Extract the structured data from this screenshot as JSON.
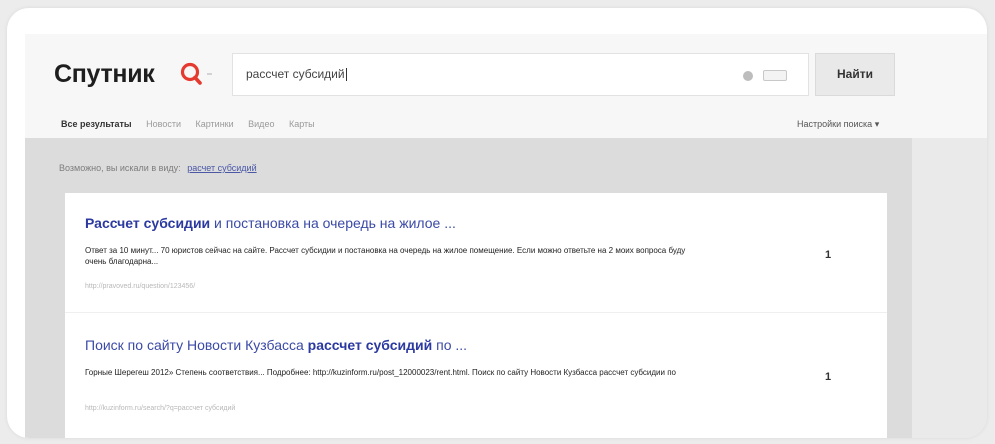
{
  "header": {
    "logo_text": "Спутник",
    "search_value": "рассчет субсидий",
    "find_button": "Найти"
  },
  "tabs": [
    {
      "label": "Все результаты",
      "active": true
    },
    {
      "label": "Новости",
      "active": false
    },
    {
      "label": "Картинки",
      "active": false
    },
    {
      "label": "Видео",
      "active": false
    },
    {
      "label": "Карты",
      "active": false
    }
  ],
  "settings_label": "Настройки поиска",
  "hint": {
    "text": "Возможно, вы искали в виду:",
    "suggestion": "расчет субсидий"
  },
  "results": [
    {
      "title_bold": "Рассчет субсидии",
      "title_rest": " и постановка на очередь на жилое ...",
      "snippet": "Ответ за 10 минут... 70 юристов сейчас на сайте. Рассчет субсидии и постановка на очередь на жилое помещение. Если можно ответьте на 2 моих вопроса буду очень благодарна...",
      "url": "http://pravoved.ru/question/123456/",
      "rank": "1"
    },
    {
      "title_start": "Поиск по сайту Новости Кузбасса ",
      "title_bold": "рассчет субсидий",
      "title_end": " по ...",
      "snippet": "Горные Шерегеш 2012» Степень соответствия... Подробнее: http://kuzinform.ru/post_12000023/rent.html. Поиск по сайту Новости Кузбасса рассчет субсидии по",
      "url": "http://kuzinform.ru/search/?q=рассчет субсидий",
      "rank": "1"
    }
  ],
  "colors": {
    "accent": "#e53a2f",
    "link": "#3b4aa6"
  }
}
